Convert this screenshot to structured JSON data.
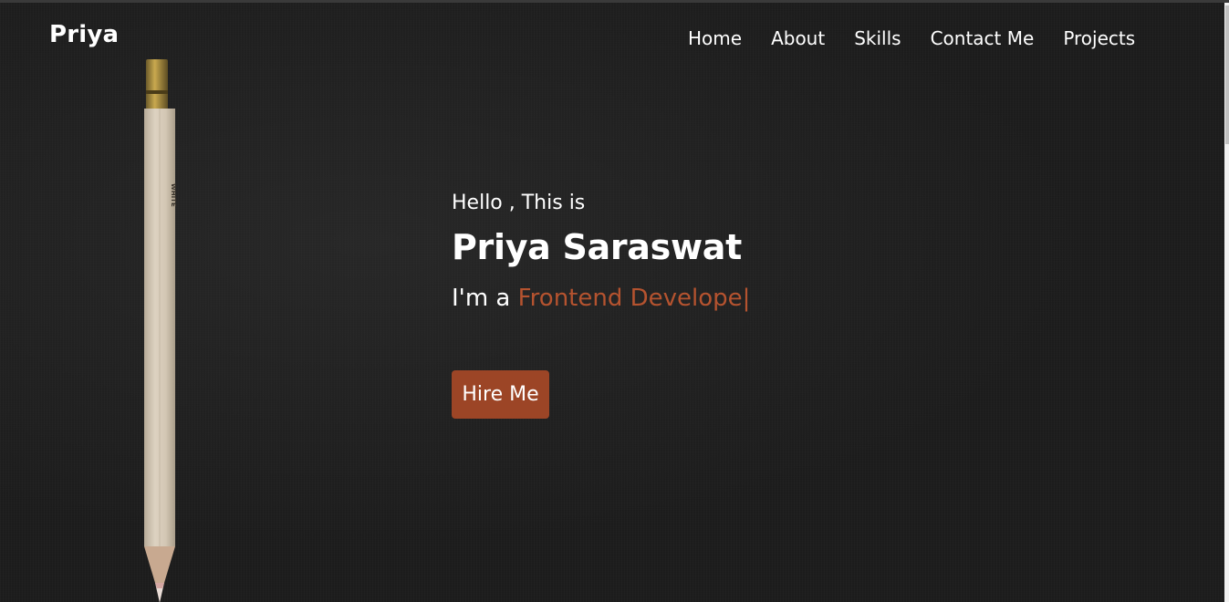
{
  "brand": {
    "logo_text": "Priya"
  },
  "nav": {
    "items": [
      {
        "label": "Home"
      },
      {
        "label": "About"
      },
      {
        "label": "Skills"
      },
      {
        "label": "Contact Me"
      },
      {
        "label": "Projects"
      }
    ]
  },
  "hero": {
    "greeting": "Hello , This is",
    "name": "Priya Saraswat",
    "role_prefix": "I'm a ",
    "role_typed": "Frontend Develope",
    "cursor": "|",
    "cta_label": "Hire Me",
    "pencil_text": "WHITE"
  },
  "colors": {
    "background": "#1c1c1c",
    "accent": "#9c4526",
    "accent_text": "#b5532f",
    "text": "#ffffff"
  }
}
